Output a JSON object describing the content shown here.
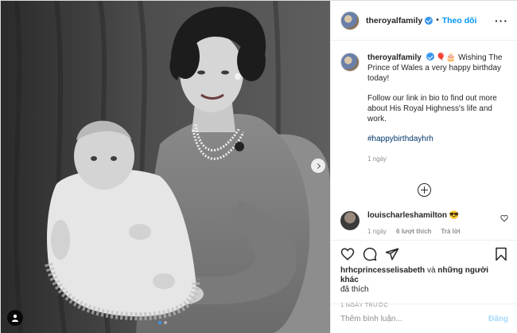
{
  "post": {
    "account": "theroyalfamily",
    "verified": true,
    "follow_separator": "•",
    "follow_label": "Theo dõi",
    "more_label": "···",
    "caption_emoji": "🎈🎂",
    "caption_line1": "Wishing The Prince of Wales a very happy birthday today!",
    "caption_line2": "Follow our link in bio to find out more about His Royal Highness's life and work.",
    "hashtag": "#happybirthdayhrh",
    "caption_time": "1 ngày",
    "photo_description_icon": "photo-black-and-white-portrait"
  },
  "comment": {
    "user": "louischarleshamilton",
    "text": "😎",
    "time": "1 ngày",
    "likes": "6 lượt thích",
    "reply": "Trả lời"
  },
  "likes_line": {
    "user": "hrhcprincesselisabeth",
    "connector": "và",
    "others": "những người khác",
    "suffix": "đã thích"
  },
  "posted_ago": "1 NGÀY TRƯỚC",
  "add_comment": {
    "placeholder": "Thêm bình luận...",
    "post_label": "Đăng"
  },
  "carousel": {
    "slides": 2,
    "active": 1
  },
  "colors": {
    "accent": "#0095f6",
    "text": "#262626",
    "muted": "#8e8e8e",
    "border": "#efefef"
  },
  "icons": [
    "heart-icon",
    "comment-icon",
    "share-icon",
    "bookmark-icon",
    "add-circle-icon",
    "chevron-right-icon",
    "tag-user-icon",
    "verified-badge-icon"
  ]
}
